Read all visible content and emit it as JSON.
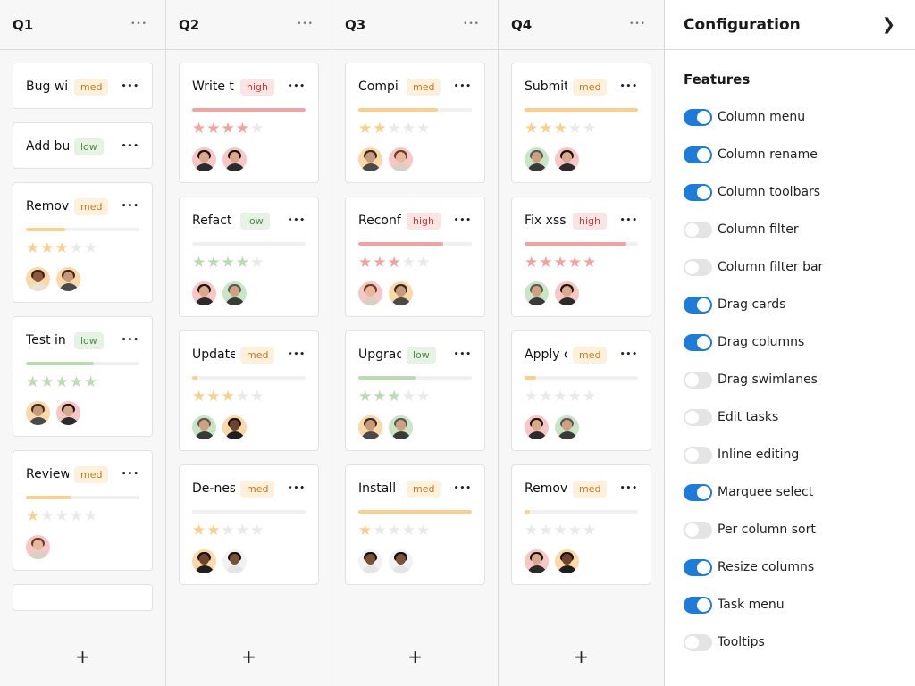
{
  "columns": [
    {
      "title": "Q1",
      "cards": [
        {
          "name": "Bug wi",
          "priority": "med",
          "progress": null,
          "rating": null,
          "assignees": []
        },
        {
          "name": "Add bu",
          "priority": "low",
          "progress": null,
          "rating": null,
          "assignees": []
        },
        {
          "name": "Remov",
          "priority": "med",
          "progress": 0.35,
          "rating": 3,
          "assignees": [
            "woman-curly",
            "man-beard"
          ]
        },
        {
          "name": "Test in",
          "priority": "low",
          "progress": 0.6,
          "rating": 5,
          "assignees": [
            "man-beard",
            "woman-dark"
          ]
        },
        {
          "name": "Review",
          "priority": "med",
          "progress": 0.4,
          "rating": 1,
          "assignees": [
            "woman-light"
          ]
        },
        {
          "name": "",
          "priority": "",
          "progress": null,
          "rating": null,
          "assignees": []
        }
      ]
    },
    {
      "title": "Q2",
      "cards": [
        {
          "name": "Write t",
          "priority": "high",
          "progress": 1.0,
          "rating": 4,
          "assignees": [
            "woman-dark",
            "woman-dark"
          ]
        },
        {
          "name": "Refact",
          "priority": "low",
          "progress": 0.0,
          "rating": 4,
          "assignees": [
            "woman-dark",
            "man-gray"
          ]
        },
        {
          "name": "Update",
          "priority": "med",
          "progress": 0.05,
          "rating": 3,
          "assignees": [
            "man-gray",
            "woman-black"
          ]
        },
        {
          "name": "De-nes",
          "priority": "med",
          "progress": 0.0,
          "rating": 2,
          "assignees": [
            "woman-black",
            "man-black"
          ]
        }
      ]
    },
    {
      "title": "Q3",
      "cards": [
        {
          "name": "Compi",
          "priority": "med",
          "progress": 0.7,
          "rating": 2,
          "assignees": [
            "man-beard",
            "woman-light"
          ]
        },
        {
          "name": "Reconf",
          "priority": "high",
          "progress": 0.75,
          "rating": 3,
          "assignees": [
            "woman-light",
            "man-beard"
          ]
        },
        {
          "name": "Upgrad",
          "priority": "low",
          "progress": 0.5,
          "rating": 3,
          "assignees": [
            "man-beard",
            "man-gray"
          ]
        },
        {
          "name": "Install",
          "priority": "med",
          "progress": 1.0,
          "rating": 1,
          "assignees": [
            "man-black",
            "man-black"
          ]
        }
      ]
    },
    {
      "title": "Q4",
      "cards": [
        {
          "name": "Submit",
          "priority": "med",
          "progress": 1.0,
          "rating": 3,
          "assignees": [
            "man-gray",
            "woman-dark"
          ]
        },
        {
          "name": "Fix xss",
          "priority": "high",
          "progress": 0.9,
          "rating": 5,
          "assignees": [
            "man-gray",
            "woman-dark"
          ]
        },
        {
          "name": "Apply c",
          "priority": "med",
          "progress": 0.1,
          "rating": 0,
          "assignees": [
            "woman-dark",
            "man-gray"
          ]
        },
        {
          "name": "Remov",
          "priority": "med",
          "progress": 0.05,
          "rating": 0,
          "assignees": [
            "woman-dark",
            "woman-black"
          ]
        }
      ]
    }
  ],
  "add_label": "+",
  "config": {
    "title": "Configuration",
    "section": "Features",
    "features": [
      {
        "label": "Column menu",
        "on": true
      },
      {
        "label": "Column rename",
        "on": true
      },
      {
        "label": "Column toolbars",
        "on": true
      },
      {
        "label": "Column filter",
        "on": false
      },
      {
        "label": "Column filter bar",
        "on": false
      },
      {
        "label": "Drag cards",
        "on": true
      },
      {
        "label": "Drag columns",
        "on": true
      },
      {
        "label": "Drag swimlanes",
        "on": false
      },
      {
        "label": "Edit tasks",
        "on": false
      },
      {
        "label": "Inline editing",
        "on": false
      },
      {
        "label": "Marquee select",
        "on": true
      },
      {
        "label": "Per column sort",
        "on": false
      },
      {
        "label": "Resize columns",
        "on": true
      },
      {
        "label": "Task menu",
        "on": true
      },
      {
        "label": "Tooltips",
        "on": false
      }
    ]
  },
  "colors": {
    "med": "#f9cf8e",
    "low": "#b8dbb2",
    "high": "#f1a3a3",
    "toggle_on": "#1e7bd8"
  },
  "icons": {
    "column_menu": "more-horizontal-icon",
    "card_menu": "more-horizontal-icon",
    "add": "plus-icon",
    "collapse": "chevron-right-icon",
    "star": "star-icon"
  }
}
